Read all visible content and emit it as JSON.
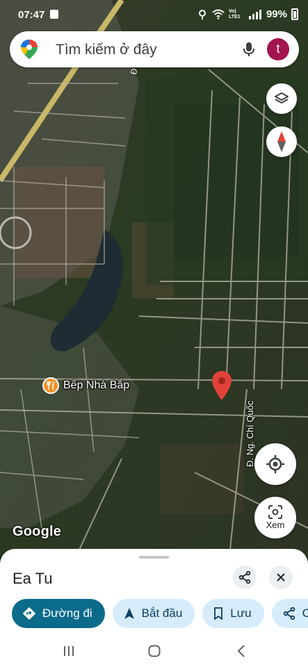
{
  "status_bar": {
    "time": "07:47",
    "network": "Vo) LTE1",
    "battery": "99%"
  },
  "search": {
    "placeholder": "Tìm kiếm ở đây",
    "avatar_letter": "t"
  },
  "map": {
    "attribution": "Google",
    "poi_label": "Bếp Nhà Bắp",
    "road_label_right": "Đ. Ng. Chí Quốc",
    "road_label_top": "Đ",
    "view_button_label": "Xem"
  },
  "place_sheet": {
    "title": "Ea Tu",
    "actions": [
      {
        "label": "Đường đi",
        "icon": "directions-icon"
      },
      {
        "label": "Bắt đầu",
        "icon": "navigation-icon"
      },
      {
        "label": "Lưu",
        "icon": "bookmark-icon"
      },
      {
        "label": "C",
        "icon": "share-icon"
      }
    ]
  },
  "colors": {
    "primary_chip": "#0b6b8a",
    "secondary_chip": "#d6ecfb",
    "marker": "#e0423a",
    "avatar": "#a3154e"
  }
}
